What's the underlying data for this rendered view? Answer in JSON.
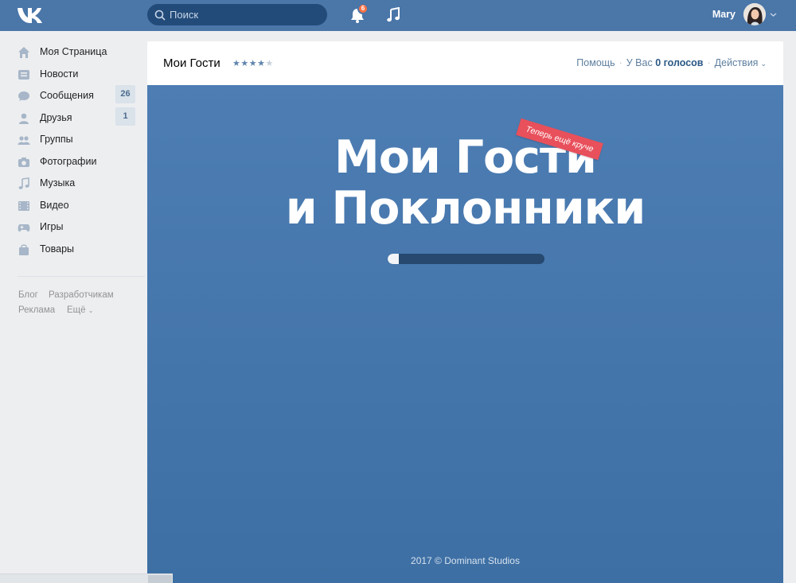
{
  "topbar": {
    "logo_icon": "vk-logo-icon",
    "search_placeholder": "Поиск",
    "notifications_count": "6",
    "user_name": "Mary",
    "accent_color": "#4a76a8"
  },
  "sidebar": {
    "items": [
      {
        "label": "Моя Страница",
        "icon": "home-icon"
      },
      {
        "label": "Новости",
        "icon": "news-icon"
      },
      {
        "label": "Сообщения",
        "icon": "messages-icon",
        "count": "26"
      },
      {
        "label": "Друзья",
        "icon": "friends-icon",
        "count": "1"
      },
      {
        "label": "Группы",
        "icon": "groups-icon"
      },
      {
        "label": "Фотографии",
        "icon": "photos-icon"
      },
      {
        "label": "Музыка",
        "icon": "music-icon"
      },
      {
        "label": "Видео",
        "icon": "video-icon"
      },
      {
        "label": "Игры",
        "icon": "games-icon"
      },
      {
        "label": "Товары",
        "icon": "goods-icon"
      }
    ],
    "footer_links": {
      "blog": "Блог",
      "developers": "Разработчикам",
      "ads": "Реклама",
      "more": "Ещё"
    }
  },
  "app_header": {
    "title": "Мои Гости",
    "rating": 4,
    "rating_max": 5,
    "help": "Помощь",
    "votes_prefix": "У Вас",
    "votes_value": "0 голосов",
    "actions": "Действия"
  },
  "app_splash": {
    "title_line1": "Мои Гости",
    "title_line2": "и Поклонники",
    "ribbon": "Теперь ещё круче",
    "progress": 0.07,
    "copyright": "2017 © Dominant Studios",
    "background_color": "#4a79ae",
    "ribbon_color": "#e8505b"
  }
}
